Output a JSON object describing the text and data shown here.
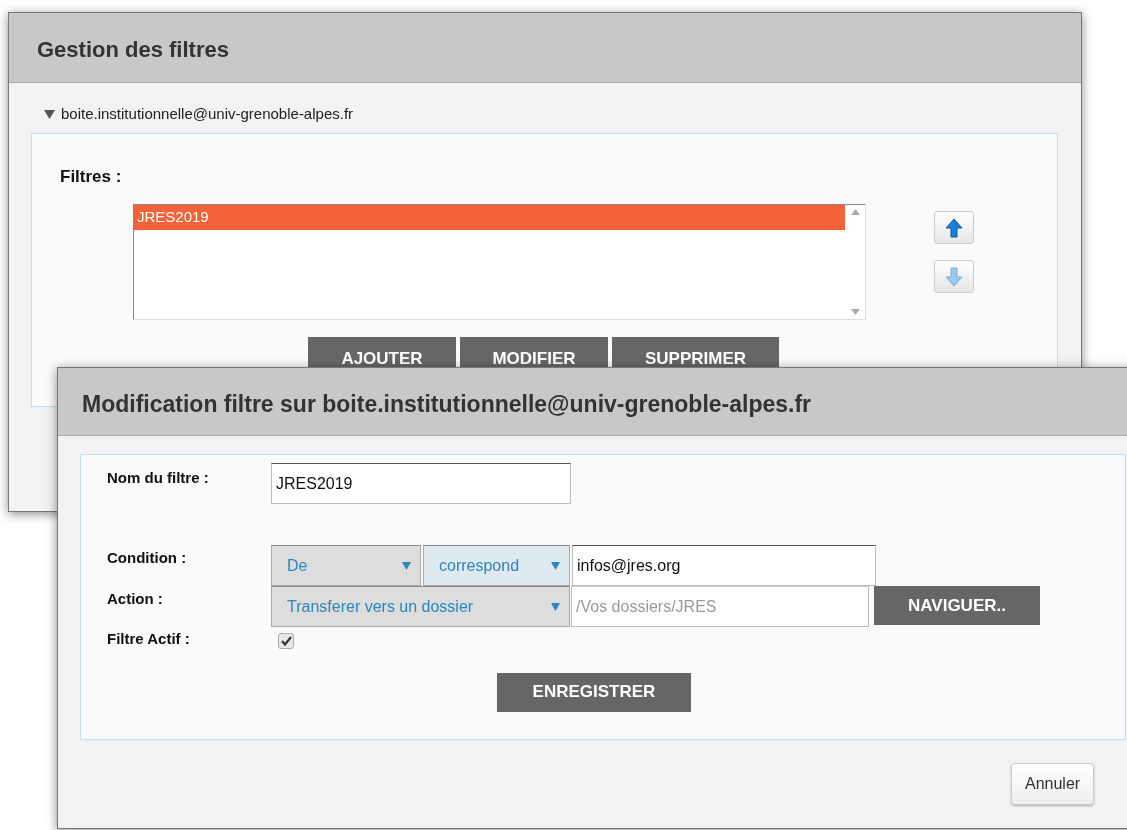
{
  "background_window": {
    "title": "Gestion des filtres",
    "account": {
      "label": "boite.institutionnelle@univ-grenoble-alpes.fr",
      "expanded": true
    },
    "filters_label": "Filtres :",
    "filters": [
      {
        "name": "JRES2019",
        "selected": true
      }
    ],
    "buttons": [
      "AJOUTER",
      "MODIFIER",
      "SUPPRIMER"
    ]
  },
  "dialog": {
    "title": "Modification filtre sur boite.institutionnelle@univ-grenoble-alpes.fr",
    "name_row": {
      "label": "Nom du filtre :",
      "value": "JRES2019"
    },
    "condition_row": {
      "label": "Condition :",
      "field": "De",
      "operator": "correspond",
      "value": "infos@jres.org"
    },
    "action_row": {
      "label": "Action :",
      "action": "Transferer vers un dossier",
      "path_placeholder": "/Vos dossiers/JRES",
      "browse_button": "NAVIGUER.."
    },
    "active_row": {
      "label": "Filtre Actif :",
      "checked": true
    },
    "save_button": "ENREGISTRER",
    "cancel_button": "Annuler"
  }
}
